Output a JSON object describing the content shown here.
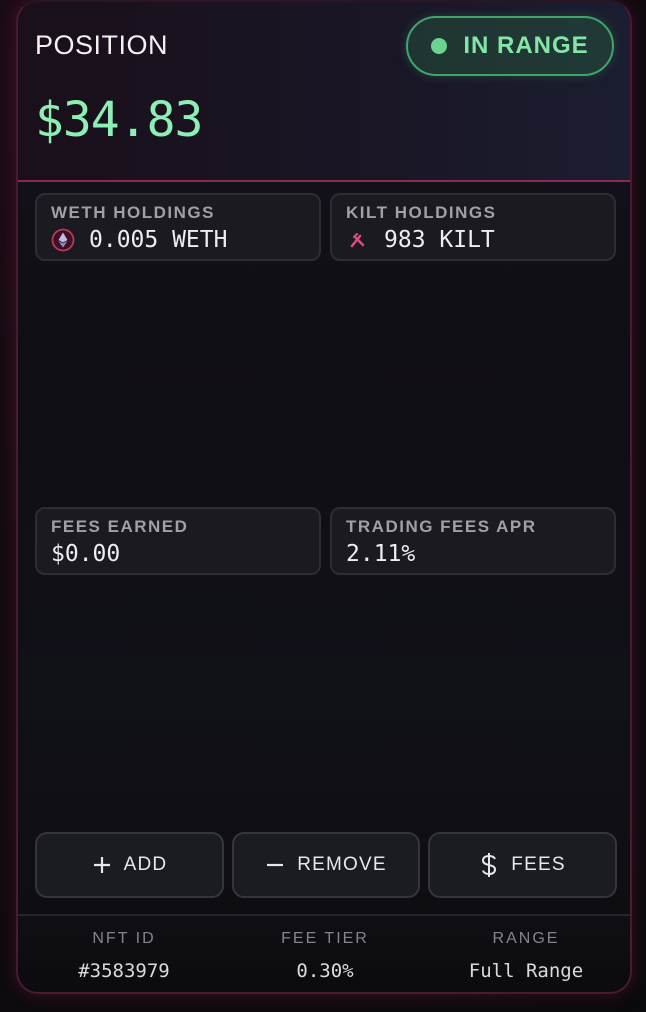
{
  "position": {
    "title": "POSITION",
    "value": "$34.83",
    "status": {
      "label": "IN RANGE",
      "color": "#6ad38e"
    }
  },
  "holdings": [
    {
      "label": "WETH HOLDINGS",
      "value": "0.005 WETH",
      "icon": "ethereum-icon"
    },
    {
      "label": "KILT HOLDINGS",
      "value": "983 KILT",
      "icon": "kilt-icon"
    }
  ],
  "fees": [
    {
      "label": "FEES EARNED",
      "value": "$0.00"
    },
    {
      "label": "TRADING FEES APR",
      "value": "2.11%"
    }
  ],
  "actions": [
    {
      "label": "ADD",
      "icon": "plus-icon"
    },
    {
      "label": "REMOVE",
      "icon": "minus-icon"
    },
    {
      "label": "FEES",
      "icon": "dollar-icon"
    }
  ],
  "footer": [
    {
      "label": "NFT ID",
      "value": "#3583979"
    },
    {
      "label": "FEE TIER",
      "value": "0.30%"
    },
    {
      "label": "RANGE",
      "value": "Full Range"
    }
  ],
  "colors": {
    "accent": "#8cf0b4",
    "border_accent": "#8a2a4c"
  }
}
